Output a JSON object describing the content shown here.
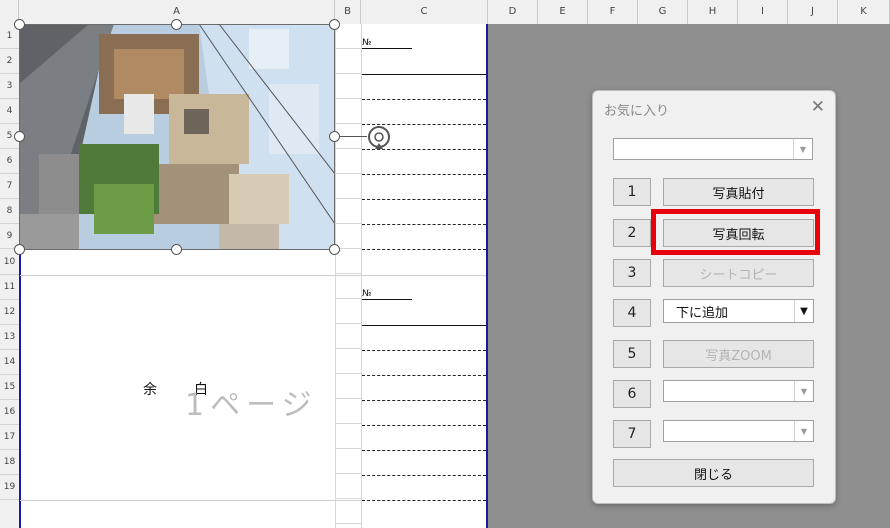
{
  "sheet": {
    "columns": [
      "A",
      "B",
      "C",
      "D",
      "E",
      "F",
      "G",
      "H",
      "I",
      "J",
      "K"
    ],
    "rows": [
      "1",
      "2",
      "3",
      "4",
      "5",
      "6",
      "7",
      "8",
      "9",
      "10",
      "11",
      "12",
      "13",
      "14",
      "15",
      "16",
      "17",
      "18",
      "19"
    ],
    "no_label": "№",
    "margin_left": "余",
    "margin_right": "白",
    "page_label": "1ページ"
  },
  "dialog": {
    "title": "お気に入り",
    "close_icon": "close-icon",
    "top_combo_value": "",
    "buttons": [
      {
        "num": "1",
        "label": "写真貼付",
        "enabled": true
      },
      {
        "num": "2",
        "label": "写真回転",
        "enabled": true
      },
      {
        "num": "3",
        "label": "シートコピー",
        "enabled": false
      },
      {
        "num": "4",
        "label": "下に追加",
        "enabled": true,
        "type": "combo"
      },
      {
        "num": "5",
        "label": "写真ZOOM",
        "enabled": false
      },
      {
        "num": "6",
        "label": "",
        "enabled": false,
        "type": "combo"
      },
      {
        "num": "7",
        "label": "",
        "enabled": false,
        "type": "combo"
      }
    ],
    "close_button_label": "閉じる"
  },
  "highlight_color": "#e8000a",
  "border_color": "#1a1aa0"
}
